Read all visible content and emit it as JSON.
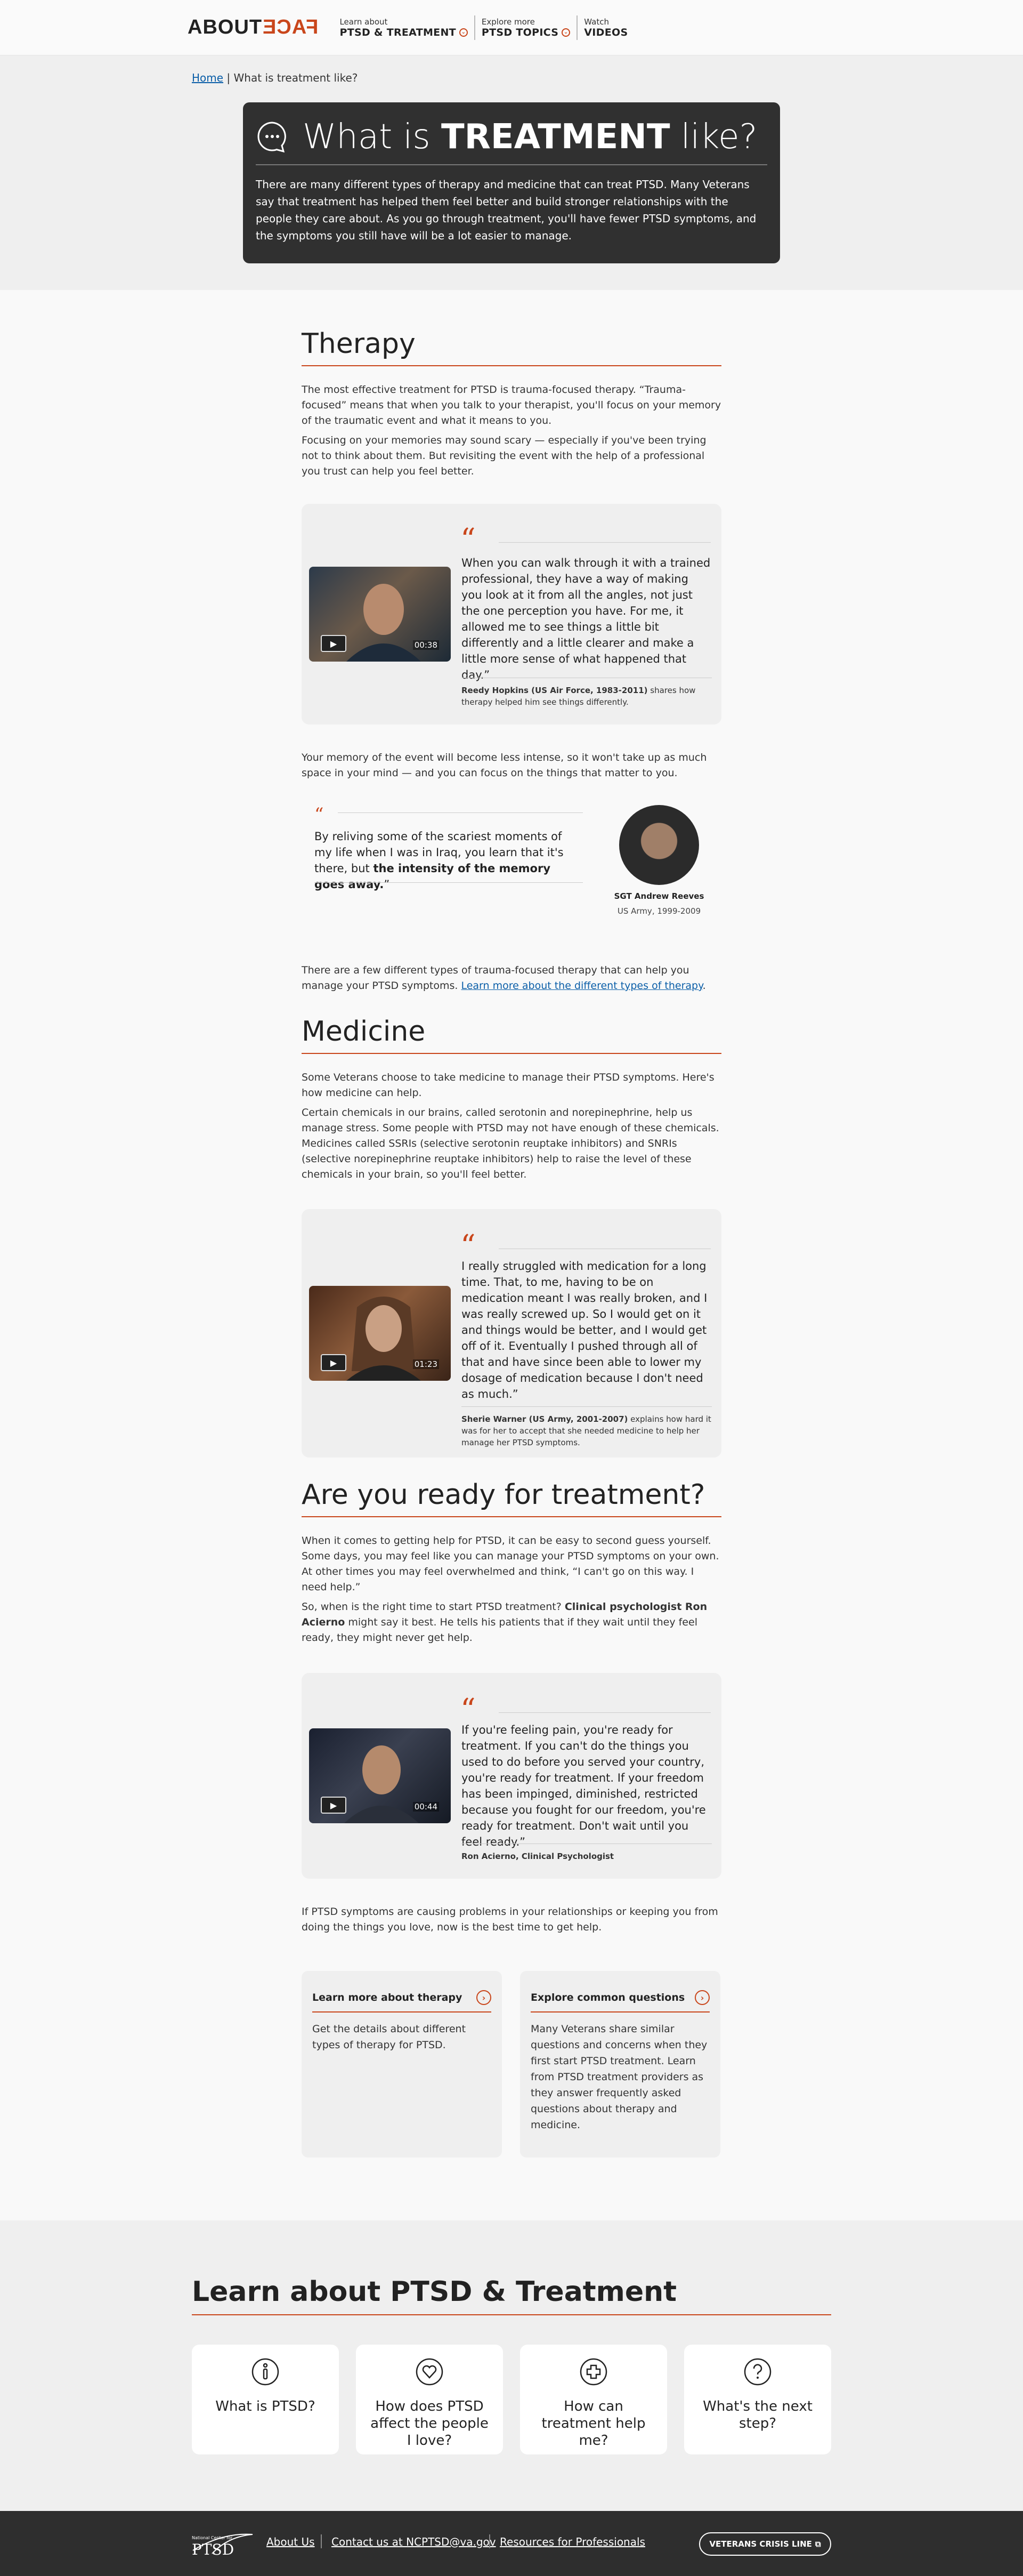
{
  "header": {
    "logo_about": "ABOUT",
    "logo_face": "FACE",
    "nav": [
      {
        "small": "Learn about",
        "big": "PTSD & TREATMENT"
      },
      {
        "small": "Explore more",
        "big": "PTSD TOPICS"
      },
      {
        "small": "Watch",
        "big": "VIDEOS"
      }
    ]
  },
  "breadcrumb": {
    "home": "Home",
    "sep": "|",
    "current": "What is treatment like?"
  },
  "hero": {
    "title_pre": "What is",
    "title_bold": "TREATMENT",
    "title_post": "like?",
    "text": "There are many different types of therapy and medicine that can treat PTSD. Many Veterans say that treatment has helped them feel better and build stronger relationships with the people they care about. As you go through treatment, you'll have fewer PTSD symptoms, and the symptoms you still have will be a lot easier to manage."
  },
  "therapy": {
    "heading": "Therapy",
    "p1": "The most effective treatment for PTSD is trauma-focused therapy. “Trauma-focused” means that when you talk to your therapist, you'll focus on your memory of the traumatic event and what it means to you.",
    "p2": "Focusing on your memories may sound scary — especially if you've been trying not to think about them. But revisiting the event with the help of a professional you trust can help you feel better.",
    "quote1": {
      "duration": "00:38",
      "text": "When you can walk through it with a trained professional, they have a way of making you look at it from all the angles, not just the one perception you have. For me, it allowed me to see things a little bit differently and a little clearer and make a little more sense of what happened that day.”",
      "name": "Reedy Hopkins (US Air Force, 1983-2011)",
      "caption": " shares how therapy helped him see things differently."
    },
    "p3": "Your memory of the event will become less intense, so it won't take up as much space in your mind — and you can focus on the things that matter to you.",
    "quote2": {
      "text_pre": "By reliving some of the scariest moments of my life when I was in Iraq, you learn that it's there, but ",
      "text_bold": "the intensity of the memory goes away.",
      "text_post": "”",
      "name": "SGT Andrew Reeves",
      "service": "US Army, 1999-2009"
    },
    "p4_pre": "There are a few different types of trauma-focused therapy that can help you manage your PTSD symptoms. ",
    "p4_link": "Learn more about the different types of therapy",
    "p4_post": "."
  },
  "medicine": {
    "heading": "Medicine",
    "p1": "Some Veterans choose to take medicine to manage their PTSD symptoms. Here's how medicine can help.",
    "p2": "Certain chemicals in our brains, called serotonin and norepinephrine, help us manage stress. Some people with PTSD may not have enough of these chemicals. Medicines called SSRIs (selective serotonin reuptake inhibitors) and SNRIs (selective norepinephrine reuptake inhibitors) help to raise the level of these chemicals in your brain, so you'll feel better.",
    "quote": {
      "duration": "01:23",
      "text": "I really struggled with medication for a long time. That, to me, having to be on medication meant I was really broken, and I was really screwed up. So I would get on it and things would be better, and I would get off of it. Eventually I pushed through all of that and have since been able to lower my dosage of medication because I don't need as much.”",
      "name": "Sherie Warner (US Army, 2001-2007)",
      "caption": " explains how hard it was for her to accept that she needed medicine to help her manage her PTSD symptoms."
    }
  },
  "ready": {
    "heading": "Are you ready for treatment?",
    "p1": "When it comes to getting help for PTSD, it can be easy to second guess yourself. Some days, you may feel like you can manage your PTSD symptoms on your own. At other times you may feel overwhelmed and think, “I can't go on this way. I need help.”",
    "p2_pre": "So, when is the right time to start PTSD treatment? ",
    "p2_bold": "Clinical psychologist Ron Acierno",
    "p2_post": " might say it best. He tells his patients that if they wait until they feel ready, they might never get help.",
    "quote": {
      "duration": "00:44",
      "text": "If you're feeling pain, you're ready for treatment. If you can't do the things you used to do before you served your country, you're ready for treatment. If your freedom has been impinged, diminished, restricted because you fought for our freedom, you're ready for treatment. Don't wait until you feel ready.”",
      "name": "Ron Acierno, Clinical Psychologist"
    },
    "p3": "If PTSD symptoms are causing problems in your relationships or keeping you from doing the things you love, now is the best time to get help."
  },
  "cards": [
    {
      "title": "Learn more about therapy",
      "text": "Get the details about different types of therapy for PTSD."
    },
    {
      "title": "Explore common questions",
      "text": "Many Veterans share similar questions and concerns when they first start PTSD treatment. Learn from PTSD treatment providers as they answer frequently asked questions about therapy and medicine."
    }
  ],
  "learn": {
    "heading": "Learn about PTSD & Treatment",
    "items": [
      {
        "label": "What is PTSD?",
        "icon": "info-icon"
      },
      {
        "label": "How does PTSD affect the people I love?",
        "icon": "heart-icon"
      },
      {
        "label": "How can treatment help me?",
        "icon": "plus-icon"
      },
      {
        "label": "What's the next step?",
        "icon": "question-icon"
      }
    ]
  },
  "footer": {
    "logo_small": "National Center for",
    "logo_big": "PTSD",
    "links": [
      "About Us",
      "Contact us at NCPTSD@va.gov",
      "Resources for Professionals"
    ],
    "crisis": "VETERANS CRISIS LINE"
  }
}
